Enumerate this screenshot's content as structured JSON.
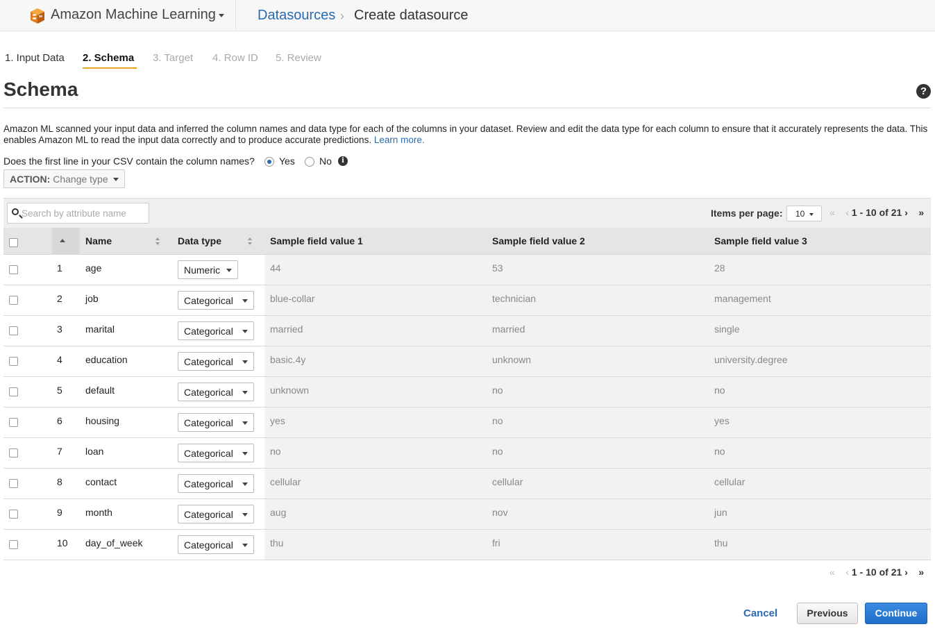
{
  "header": {
    "service_name": "Amazon Machine Learning",
    "breadcrumb_link": "Datasources",
    "breadcrumb_separator": "›",
    "breadcrumb_current": "Create datasource"
  },
  "wizard": {
    "steps": [
      "1. Input Data",
      "2. Schema",
      "3. Target",
      "4. Row ID",
      "5. Review"
    ],
    "active_step": "2. Schema",
    "accent_color": "#e8a320"
  },
  "page": {
    "title": "Schema",
    "help_icon": "?",
    "description": "Amazon ML scanned your input data and inferred the column names and data type for each of the columns in your dataset. Review and edit the data type for each column to ensure that it accurately represents the data. This enables Amazon ML to read the input data correctly and to produce accurate predictions.",
    "learn_more": "Learn more.",
    "question": "Does the first line in your CSV contain the column names?",
    "radio_yes": "Yes",
    "radio_no": "No",
    "selected_radio": "Yes",
    "info_icon": "i",
    "action_prefix": "ACTION:",
    "action_label": "Change type"
  },
  "table": {
    "search_placeholder": "Search by attribute name",
    "items_per_page_label": "Items per page:",
    "items_per_page_value": "10",
    "page_range": "1 - 10 of 21",
    "first_icon": "«",
    "prev_icon": "‹",
    "next_icon": "›",
    "last_icon": "»",
    "columns": {
      "name": "Name",
      "data_type": "Data type",
      "sample1": "Sample field value 1",
      "sample2": "Sample field value 2",
      "sample3": "Sample field value 3"
    },
    "rows": [
      {
        "index": "1",
        "name": "age",
        "type": "Numeric",
        "s1": "44",
        "s2": "53",
        "s3": "28"
      },
      {
        "index": "2",
        "name": "job",
        "type": "Categorical",
        "s1": "blue-collar",
        "s2": "technician",
        "s3": "management"
      },
      {
        "index": "3",
        "name": "marital",
        "type": "Categorical",
        "s1": "married",
        "s2": "married",
        "s3": "single"
      },
      {
        "index": "4",
        "name": "education",
        "type": "Categorical",
        "s1": "basic.4y",
        "s2": "unknown",
        "s3": "university.degree"
      },
      {
        "index": "5",
        "name": "default",
        "type": "Categorical",
        "s1": "unknown",
        "s2": "no",
        "s3": "no"
      },
      {
        "index": "6",
        "name": "housing",
        "type": "Categorical",
        "s1": "yes",
        "s2": "no",
        "s3": "yes"
      },
      {
        "index": "7",
        "name": "loan",
        "type": "Categorical",
        "s1": "no",
        "s2": "no",
        "s3": "no"
      },
      {
        "index": "8",
        "name": "contact",
        "type": "Categorical",
        "s1": "cellular",
        "s2": "cellular",
        "s3": "cellular"
      },
      {
        "index": "9",
        "name": "month",
        "type": "Categorical",
        "s1": "aug",
        "s2": "nov",
        "s3": "jun"
      },
      {
        "index": "10",
        "name": "day_of_week",
        "type": "Categorical",
        "s1": "thu",
        "s2": "fri",
        "s3": "thu"
      }
    ]
  },
  "footer": {
    "cancel_label": "Cancel",
    "previous_label": "Previous",
    "continue_label": "Continue",
    "primary_color": "#2a6ab0"
  }
}
